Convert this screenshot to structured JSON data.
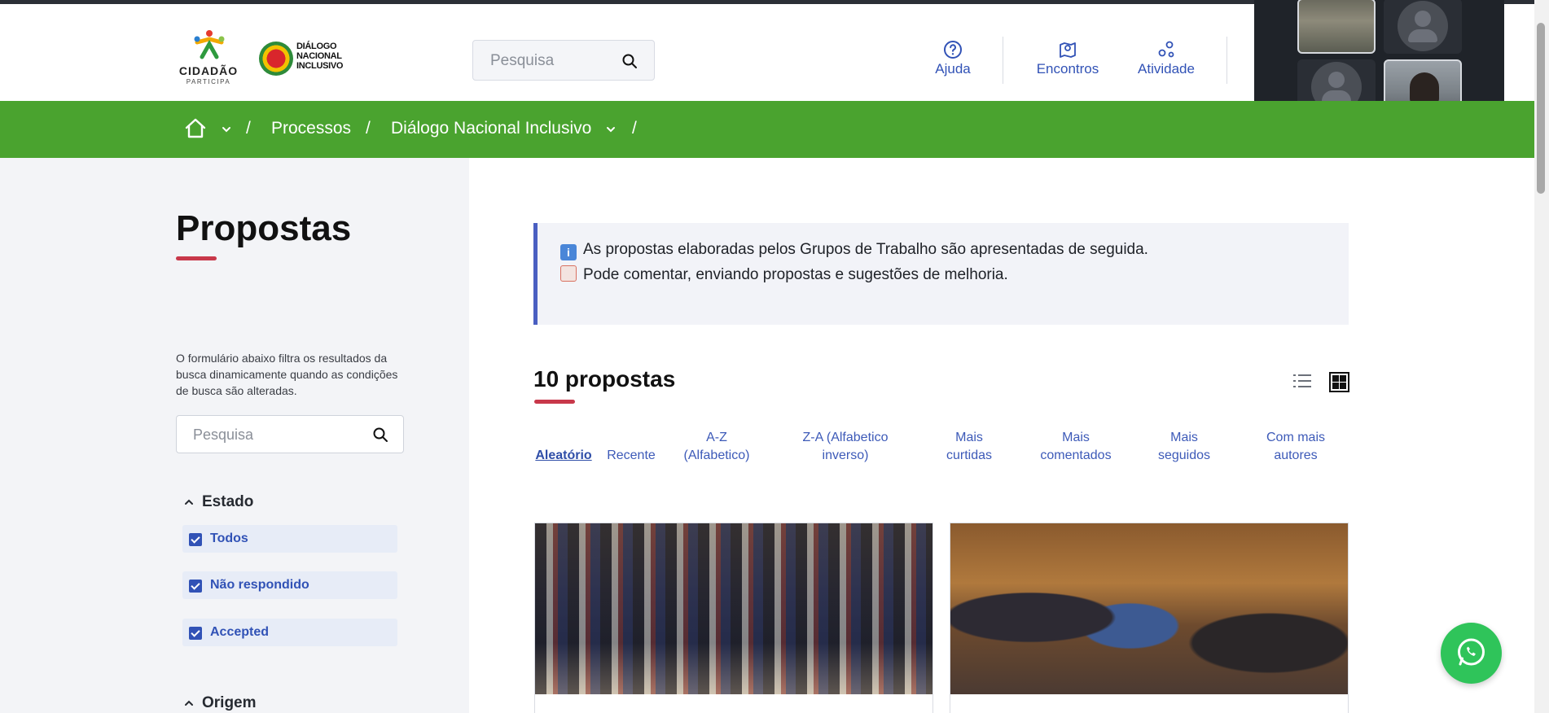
{
  "header": {
    "logo_cidadao_word": "CIDADÃO",
    "logo_cidadao_sub": "PARTICIPA",
    "logo_dni_lines": [
      "DIÁLOGO",
      "NACIONAL",
      "INCLUSIVO"
    ],
    "search_placeholder": "Pesquisa",
    "nav": [
      {
        "label": "Ajuda",
        "icon": "help-circle-icon"
      },
      {
        "label": "Encontros",
        "icon": "map-pin-icon"
      },
      {
        "label": "Atividade",
        "icon": "activity-icon"
      }
    ]
  },
  "breadcrumb": {
    "items": [
      "Processos",
      "Diálogo Nacional Inclusivo"
    ],
    "separator": "/"
  },
  "sidebar": {
    "title": "Propostas",
    "filter_description": "O formulário abaixo filtra os resultados da busca dinamicamente quando as condições de busca são alteradas.",
    "search_placeholder": "Pesquisa",
    "estado_heading": "Estado",
    "estado_options": [
      {
        "label": "Todos",
        "checked": true
      },
      {
        "label": "Não respondido",
        "checked": true
      },
      {
        "label": "Accepted",
        "checked": true
      }
    ],
    "origem_heading": "Origem"
  },
  "main": {
    "info_lines": [
      "As propostas elaboradas pelos Grupos de Trabalho são apresentadas de seguida.",
      "Pode comentar, enviando propostas e sugestões de melhoria."
    ],
    "count_title": "10 propostas",
    "sort_options": [
      {
        "label": "Aleatório",
        "active": true
      },
      {
        "label": "Recente"
      },
      {
        "label": "A-Z (Alfabetico)"
      },
      {
        "label": "Z-A (Alfabetico inverso)"
      },
      {
        "label": "Mais curtidas"
      },
      {
        "label": "Mais comentados"
      },
      {
        "label": "Mais seguidos"
      },
      {
        "label": "Com mais autores"
      }
    ]
  },
  "colors": {
    "brand_green": "#4aa32f",
    "link_blue": "#3152b6",
    "accent_red": "#c8384a",
    "whatsapp_green": "#2fc45a"
  }
}
